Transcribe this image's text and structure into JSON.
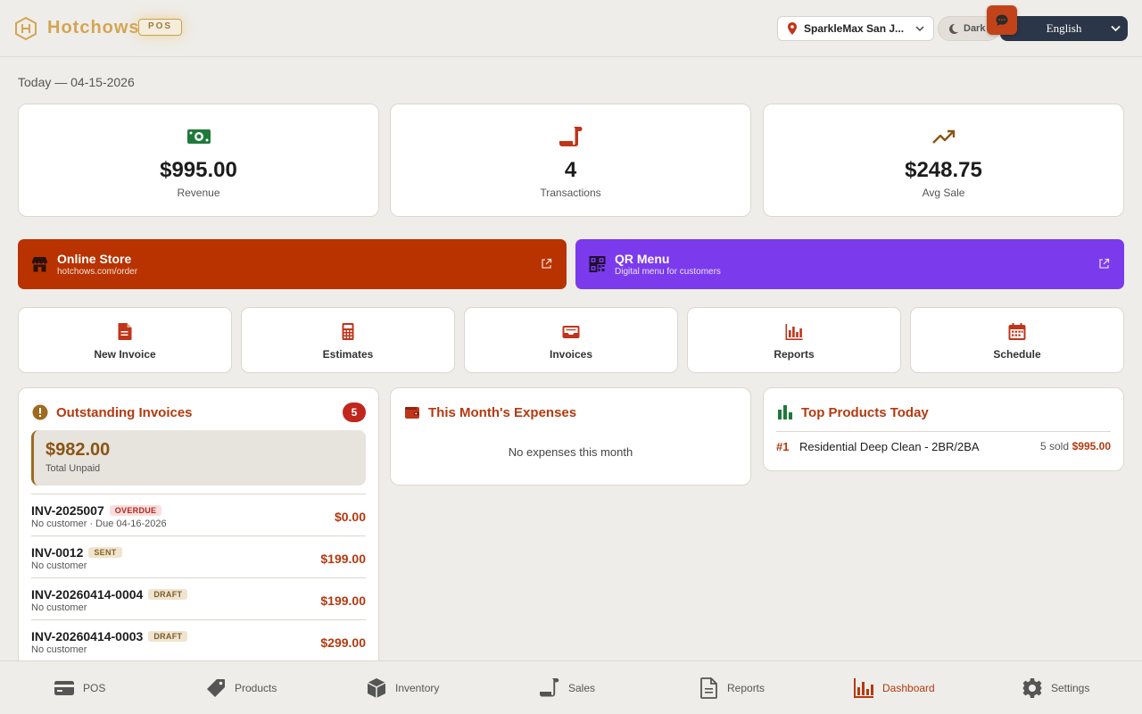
{
  "header": {
    "brand": "Hotchows",
    "badge": "POS",
    "store": "SparkleMax San J...",
    "theme_toggle": "Dark",
    "language": "English"
  },
  "date_label": "Today — 04-15-2026",
  "stats": [
    {
      "value": "$995.00",
      "label": "Revenue",
      "icon": "money-icon"
    },
    {
      "value": "4",
      "label": "Transactions",
      "icon": "receipt-icon"
    },
    {
      "value": "$248.75",
      "label": "Avg Sale",
      "icon": "trend-up-icon"
    }
  ],
  "banners": {
    "online_store": {
      "title": "Online Store",
      "subtitle": "hotchows.com/order"
    },
    "qr_menu": {
      "title": "QR Menu",
      "subtitle": "Digital menu for customers"
    }
  },
  "quick_actions": [
    {
      "label": "New Invoice"
    },
    {
      "label": "Estimates"
    },
    {
      "label": "Invoices"
    },
    {
      "label": "Reports"
    },
    {
      "label": "Schedule"
    }
  ],
  "outstanding": {
    "title": "Outstanding Invoices",
    "count": "5",
    "total": "$982.00",
    "total_label": "Total Unpaid",
    "invoices": [
      {
        "id": "INV-2025007",
        "status": "OVERDUE",
        "meta": "No customer · Due 04-16-2026",
        "amount": "$0.00"
      },
      {
        "id": "INV-0012",
        "status": "SENT",
        "meta": "No customer",
        "amount": "$199.00"
      },
      {
        "id": "INV-20260414-0004",
        "status": "DRAFT",
        "meta": "No customer",
        "amount": "$199.00"
      },
      {
        "id": "INV-20260414-0003",
        "status": "DRAFT",
        "meta": "No customer",
        "amount": "$299.00"
      }
    ]
  },
  "expenses": {
    "title": "This Month's Expenses",
    "empty": "No expenses this month"
  },
  "top_products": {
    "title": "Top Products Today",
    "items": [
      {
        "rank": "#1",
        "name": "Residential Deep Clean - 2BR/2BA",
        "sold": "5 sold",
        "amount": "$995.00"
      }
    ]
  },
  "nav": [
    {
      "label": "POS"
    },
    {
      "label": "Products"
    },
    {
      "label": "Inventory"
    },
    {
      "label": "Sales"
    },
    {
      "label": "Reports"
    },
    {
      "label": "Dashboard"
    },
    {
      "label": "Settings"
    }
  ],
  "colors": {
    "accent": "#b33a10",
    "online_store": "#b83300",
    "qr_menu": "#7c3aed",
    "brand_gold": "#d3a553",
    "revenue_green": "#1f7a3a"
  }
}
